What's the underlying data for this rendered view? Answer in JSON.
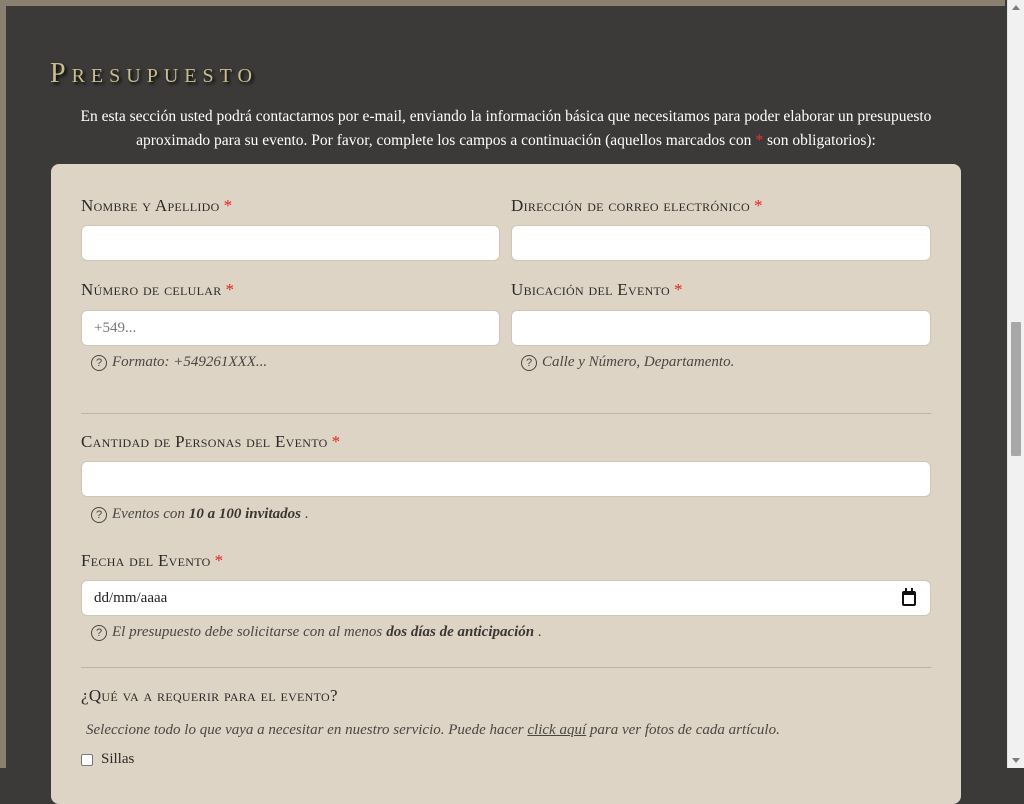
{
  "page": {
    "title": "Presupuesto",
    "intro_line1": "En esta sección usted podrá contactarnos por e-mail, enviando la información básica que necesitamos para poder elaborar un presupuesto",
    "intro_line2a": "aproximado para su evento. Por favor, complete los campos a continuación (aquellos marcados con",
    "intro_req_mark": "*",
    "intro_line2b": "son obligatorios):"
  },
  "form": {
    "required_mark": "*",
    "name": {
      "label": "Nombre y Apellido",
      "value": ""
    },
    "email": {
      "label": "Dirección de correo electrónico",
      "value": ""
    },
    "phone": {
      "label": "Número de celular",
      "placeholder": "+549...",
      "hint": "Formato: +549261XXX..."
    },
    "location": {
      "label": "Ubicación del Evento",
      "value": "",
      "hint": "Calle y Número, Departamento."
    },
    "guests": {
      "label": "Cantidad de Personas del Evento",
      "value": "",
      "hint_pre": "Eventos con",
      "hint_bold": "10 a 100 invitados",
      "hint_post": "."
    },
    "date": {
      "label": "Fecha del Evento",
      "placeholder": "dd/mm/aaaa",
      "hint_pre": "El presupuesto debe solicitarse con al menos",
      "hint_bold": "dos días de anticipación",
      "hint_post": "."
    },
    "requirements": {
      "title": "¿Qué va a requerir para el evento?",
      "desc_pre": "Seleccione todo lo que vaya a necesitar en nuestro servicio. Puede hacer",
      "desc_link": "click aquí",
      "desc_post": "para ver fotos de cada artículo.",
      "options": [
        {
          "label": "Sillas",
          "checked": false
        }
      ]
    }
  },
  "colors": {
    "background": "#3b3a39",
    "card": "#ded4c6",
    "title": "#c9bd8e",
    "required": "#e0221b"
  },
  "icons": [
    "help-circle-icon",
    "calendar-icon"
  ]
}
